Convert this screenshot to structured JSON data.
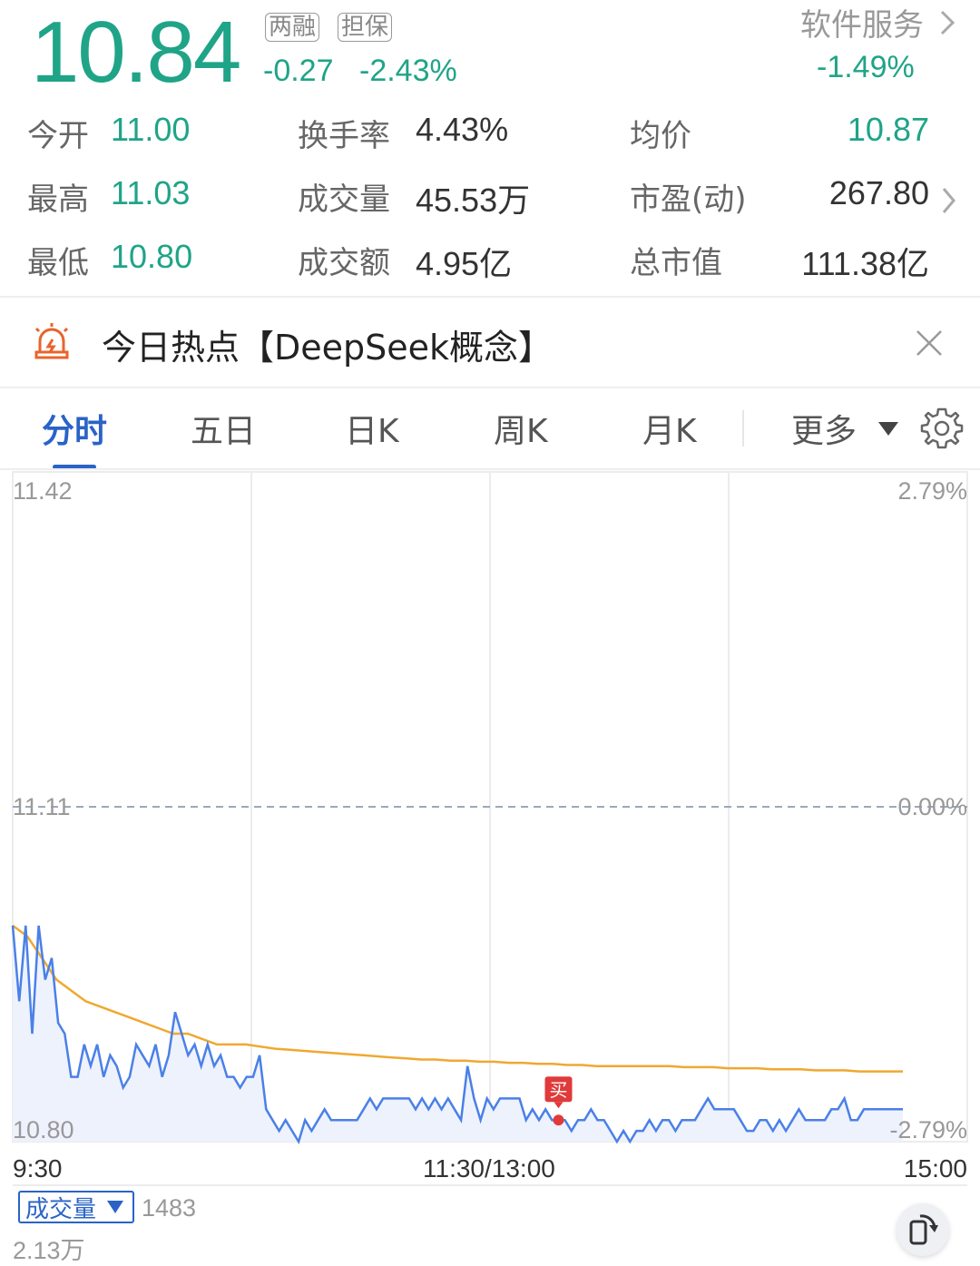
{
  "quote": {
    "price": "10.84",
    "tags": [
      "两融",
      "担保"
    ],
    "change": "-0.27",
    "change_pct": "-2.43%",
    "sector_name": "软件服务",
    "sector_change": "-1.49%",
    "colors": {
      "down": "#1fa487",
      "accent": "#2a63c7"
    }
  },
  "stats": [
    {
      "label": "今开",
      "value": "11.00"
    },
    {
      "label": "最高",
      "value": "11.03"
    },
    {
      "label": "最低",
      "value": "10.80"
    },
    {
      "label": "换手率",
      "value": "4.43%"
    },
    {
      "label": "成交量",
      "value": "45.53万"
    },
    {
      "label": "成交额",
      "value": "4.95亿"
    },
    {
      "label": "均价",
      "value": "10.87"
    },
    {
      "label": "市盈(动)",
      "value": "267.80"
    },
    {
      "label": "总市值",
      "value": "111.38亿"
    }
  ],
  "hot": {
    "text": "今日热点【DeepSeek概念】"
  },
  "tabs": [
    "分时",
    "五日",
    "日K",
    "周K",
    "月K",
    "更多"
  ],
  "chart_data": {
    "type": "line",
    "y_left_labels": [
      "11.42",
      "11.11",
      "10.80"
    ],
    "y_right_labels": [
      "2.79%",
      "0.00%",
      "-2.79%"
    ],
    "ylim": [
      10.8,
      11.42
    ],
    "prev_close": 11.11,
    "x_labels": [
      "9:30",
      "11:30/13:00",
      "15:00"
    ],
    "series": [
      {
        "name": "price",
        "values": [
          11.0,
          10.93,
          11.0,
          10.9,
          11.0,
          10.95,
          10.97,
          10.91,
          10.9,
          10.86,
          10.86,
          10.89,
          10.87,
          10.89,
          10.86,
          10.88,
          10.87,
          10.85,
          10.86,
          10.89,
          10.88,
          10.87,
          10.89,
          10.86,
          10.88,
          10.92,
          10.9,
          10.88,
          10.89,
          10.87,
          10.89,
          10.87,
          10.88,
          10.86,
          10.86,
          10.85,
          10.86,
          10.86,
          10.88,
          10.83,
          10.82,
          10.81,
          10.82,
          10.81,
          10.8,
          10.82,
          10.81,
          10.82,
          10.83,
          10.82,
          10.82,
          10.82,
          10.82,
          10.82,
          10.83,
          10.84,
          10.83,
          10.84,
          10.84,
          10.84,
          10.84,
          10.84,
          10.83,
          10.84,
          10.83,
          10.84,
          10.83,
          10.84,
          10.83,
          10.82,
          10.87,
          10.84,
          10.82,
          10.84,
          10.83,
          10.84,
          10.84,
          10.84,
          10.84,
          10.82,
          10.83,
          10.82,
          10.83,
          10.82,
          10.82,
          10.82,
          10.81,
          10.82,
          10.82,
          10.83,
          10.82,
          10.82,
          10.81,
          10.8,
          10.81,
          10.8,
          10.81,
          10.81,
          10.82,
          10.81,
          10.82,
          10.82,
          10.81,
          10.82,
          10.82,
          10.82,
          10.83,
          10.84,
          10.83,
          10.83,
          10.83,
          10.83,
          10.82,
          10.81,
          10.81,
          10.82,
          10.82,
          10.81,
          10.82,
          10.81,
          10.82,
          10.83,
          10.82,
          10.82,
          10.82,
          10.82,
          10.83,
          10.83,
          10.84,
          10.82,
          10.82,
          10.83,
          10.83,
          10.83,
          10.83,
          10.83,
          10.83,
          10.83
        ]
      },
      {
        "name": "avg",
        "values": [
          11.0,
          10.99,
          10.97,
          10.95,
          10.94,
          10.93,
          10.925,
          10.92,
          10.915,
          10.91,
          10.905,
          10.9,
          10.9,
          10.895,
          10.89,
          10.89,
          10.89,
          10.888,
          10.886,
          10.885,
          10.884,
          10.883,
          10.882,
          10.881,
          10.88,
          10.879,
          10.878,
          10.877,
          10.876,
          10.876,
          10.875,
          10.875,
          10.874,
          10.874,
          10.873,
          10.873,
          10.872,
          10.872,
          10.871,
          10.871,
          10.87,
          10.87,
          10.87,
          10.87,
          10.87,
          10.87,
          10.869,
          10.869,
          10.869,
          10.868,
          10.868,
          10.868,
          10.867,
          10.867,
          10.867,
          10.866,
          10.866,
          10.866,
          10.865,
          10.865,
          10.865,
          10.865
        ]
      }
    ],
    "buy_marker": "买",
    "volume_label": "成交量",
    "volume_value": "1483",
    "volume_axis": "2.13万"
  }
}
